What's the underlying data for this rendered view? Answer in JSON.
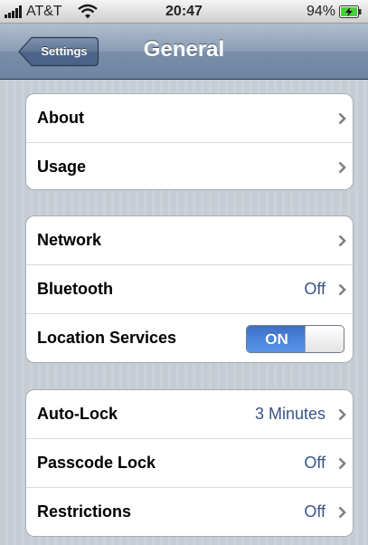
{
  "status_bar": {
    "carrier": "AT&T",
    "time": "20:47",
    "battery_percent": "94%",
    "signal_icon": "signal-bars-icon",
    "wifi_icon": "wifi-icon",
    "battery_icon": "battery-charging-icon"
  },
  "nav_bar": {
    "back_label": "Settings",
    "title": "General"
  },
  "groups": [
    {
      "rows": [
        {
          "label": "About"
        },
        {
          "label": "Usage"
        }
      ]
    },
    {
      "rows": [
        {
          "label": "Network"
        },
        {
          "label": "Bluetooth",
          "value": "Off"
        },
        {
          "label": "Location Services",
          "toggle": "ON"
        }
      ]
    },
    {
      "rows": [
        {
          "label": "Auto-Lock",
          "value": "3 Minutes"
        },
        {
          "label": "Passcode Lock",
          "value": "Off"
        },
        {
          "label": "Restrictions",
          "value": "Off"
        }
      ]
    }
  ],
  "colors": {
    "value_text": "#385487",
    "toggle_on": "#4b84dc",
    "background": "#c5ccd4"
  }
}
